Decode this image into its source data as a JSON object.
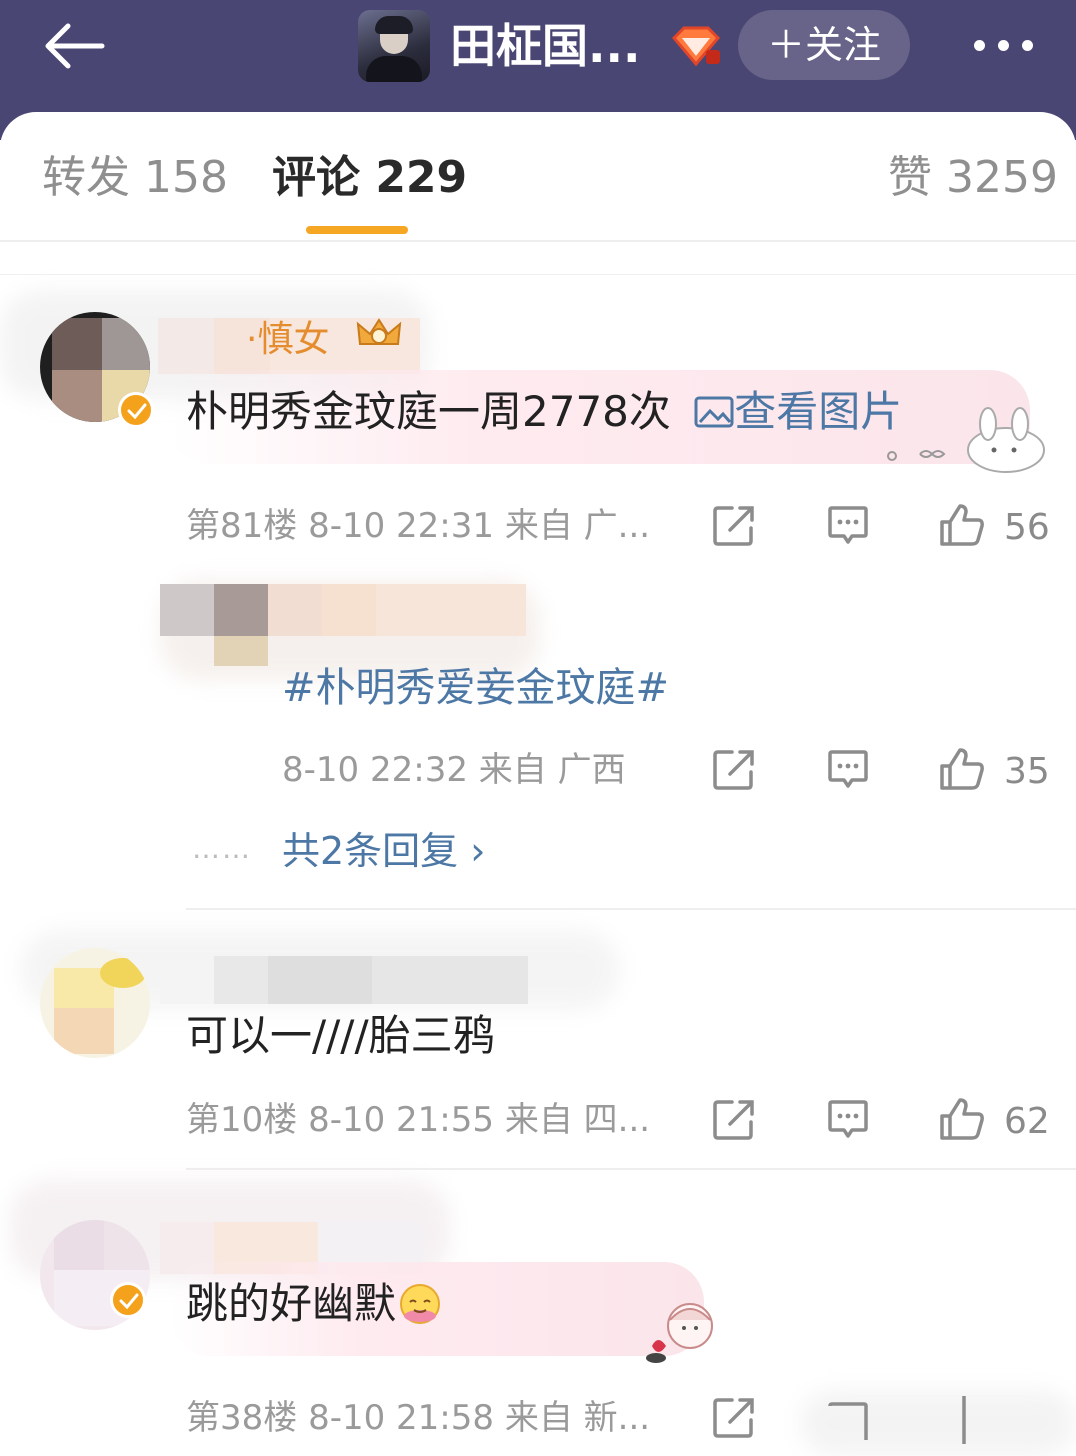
{
  "header": {
    "title": "田柾国...",
    "follow_label": "＋关注"
  },
  "tabs": {
    "forward": "转发 158",
    "comment": "评论 229",
    "like": "赞 3259"
  },
  "comments": [
    {
      "username_fragment": "·慎女",
      "text": "朴明秀金玟庭一周2778次",
      "link": "查看图片",
      "meta": "第81楼  8-10 22:31  来自 广...",
      "likes": "56",
      "reply": {
        "hashtag": "#朴明秀爱妾金玟庭#",
        "meta": "8-10 22:32  来自 广西",
        "likes": "35"
      },
      "more_replies": "共2条回复 ›",
      "more_dots": "……"
    },
    {
      "text": "可以一////胎三鸦",
      "meta": "第10楼  8-10 21:55  来自 四...",
      "likes": "62"
    },
    {
      "text": "跳的好幽默",
      "meta": "第38楼  8-10 21:58  来自 新..."
    }
  ],
  "colors": {
    "header_bg": "#4a4673",
    "accent_orange": "#f5a623",
    "link_blue": "#4d78a5"
  },
  "icons": [
    "back-arrow-icon",
    "vip-diamond-icon",
    "more-dots-icon",
    "share-icon",
    "comment-icon",
    "like-icon",
    "verified-icon",
    "crown-icon",
    "image-icon",
    "emoji-icon"
  ]
}
